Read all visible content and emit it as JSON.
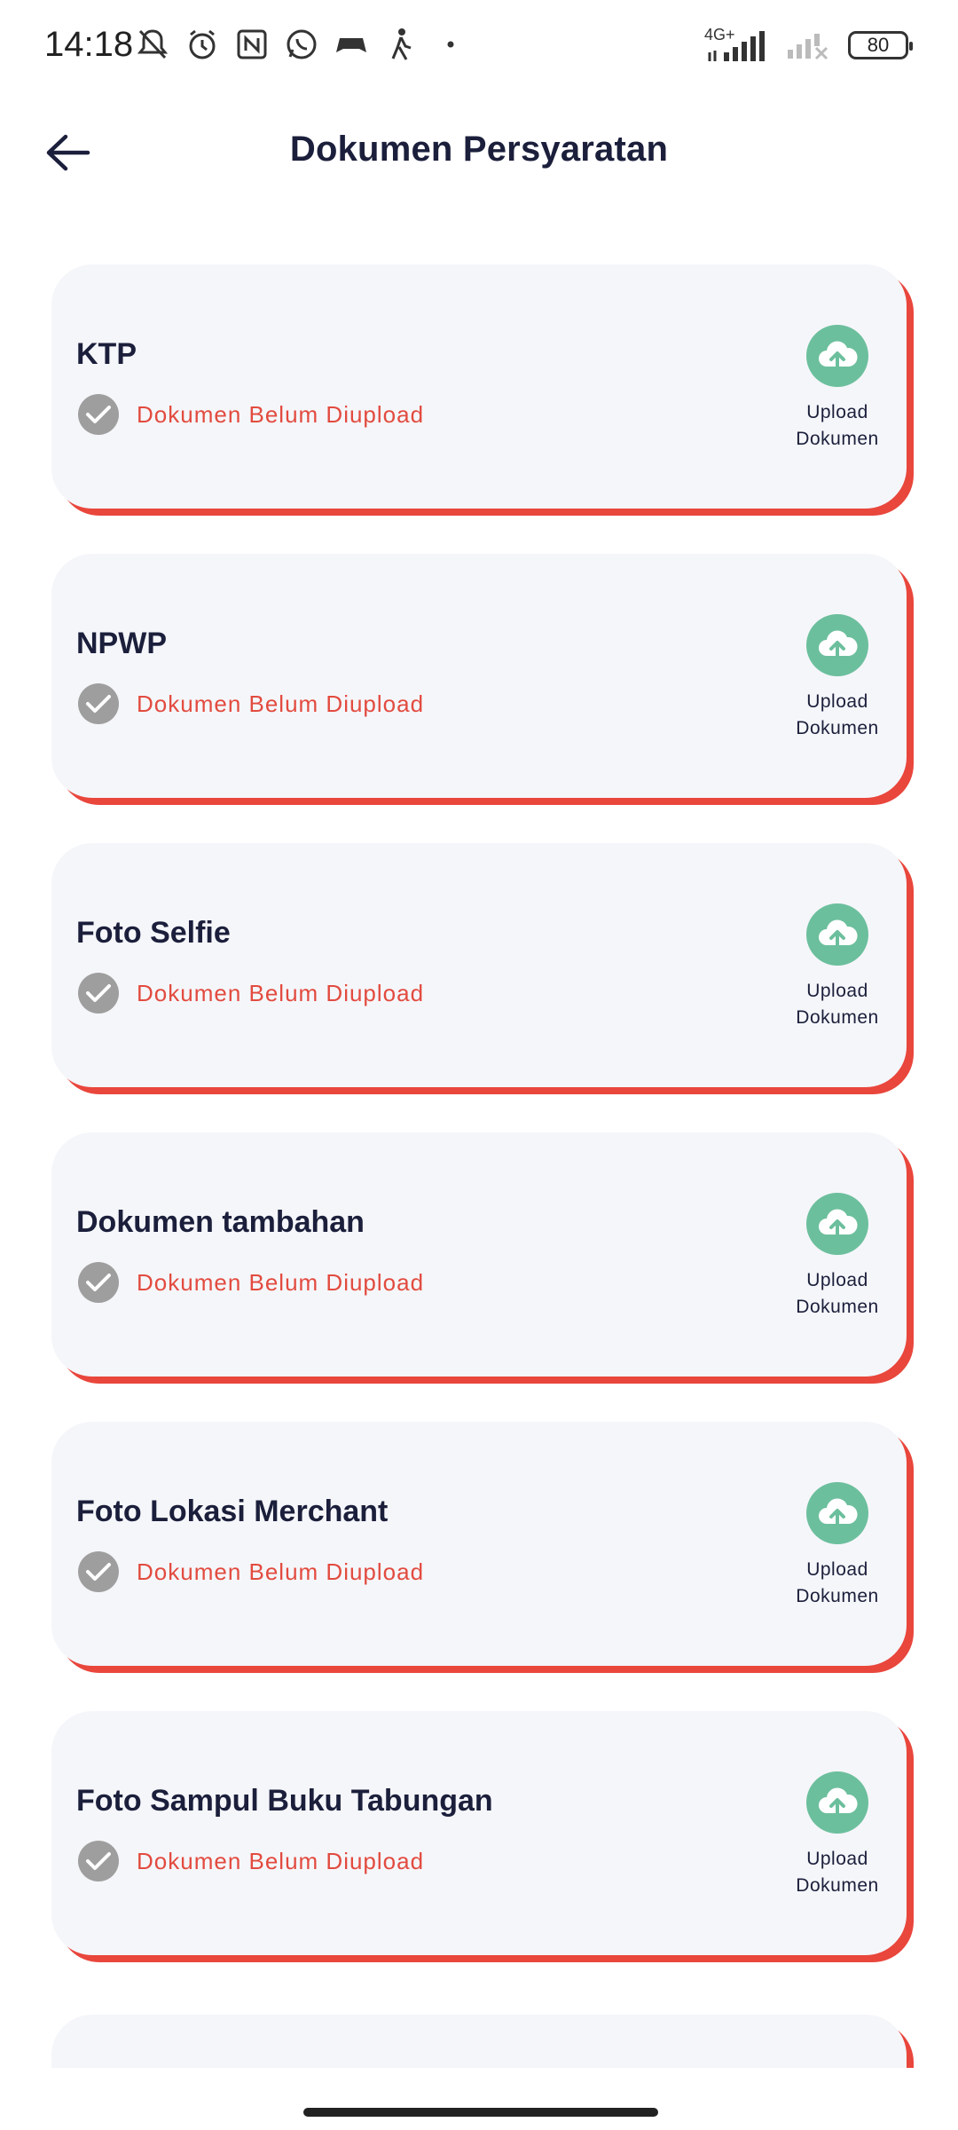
{
  "status_bar": {
    "time": "14:18",
    "network_label": "4G+",
    "battery": "80"
  },
  "header": {
    "title": "Dokumen Persyaratan"
  },
  "documents": [
    {
      "title": "KTP",
      "status": "Dokumen Belum Diupload",
      "upload_label_1": "Upload",
      "upload_label_2": "Dokumen"
    },
    {
      "title": "NPWP",
      "status": "Dokumen Belum Diupload",
      "upload_label_1": "Upload",
      "upload_label_2": "Dokumen"
    },
    {
      "title": "Foto Selfie",
      "status": "Dokumen Belum Diupload",
      "upload_label_1": "Upload",
      "upload_label_2": "Dokumen"
    },
    {
      "title": "Dokumen tambahan",
      "status": "Dokumen Belum Diupload",
      "upload_label_1": "Upload",
      "upload_label_2": "Dokumen"
    },
    {
      "title": "Foto Lokasi Merchant",
      "status": "Dokumen Belum Diupload",
      "upload_label_1": "Upload",
      "upload_label_2": "Dokumen"
    },
    {
      "title": "Foto Sampul Buku Tabungan",
      "status": "Dokumen Belum Diupload",
      "upload_label_1": "Upload",
      "upload_label_2": "Dokumen"
    }
  ],
  "colors": {
    "accent_red": "#e9463c",
    "status_red": "#e24b3f",
    "upload_green": "#6cbf9d",
    "check_gray": "#9e9e9e",
    "card_bg": "#f5f6fa",
    "title_navy": "#1b1f3b"
  },
  "icons": {
    "back": "arrow-left-icon",
    "check": "check-circle-icon",
    "upload": "cloud-upload-icon"
  }
}
